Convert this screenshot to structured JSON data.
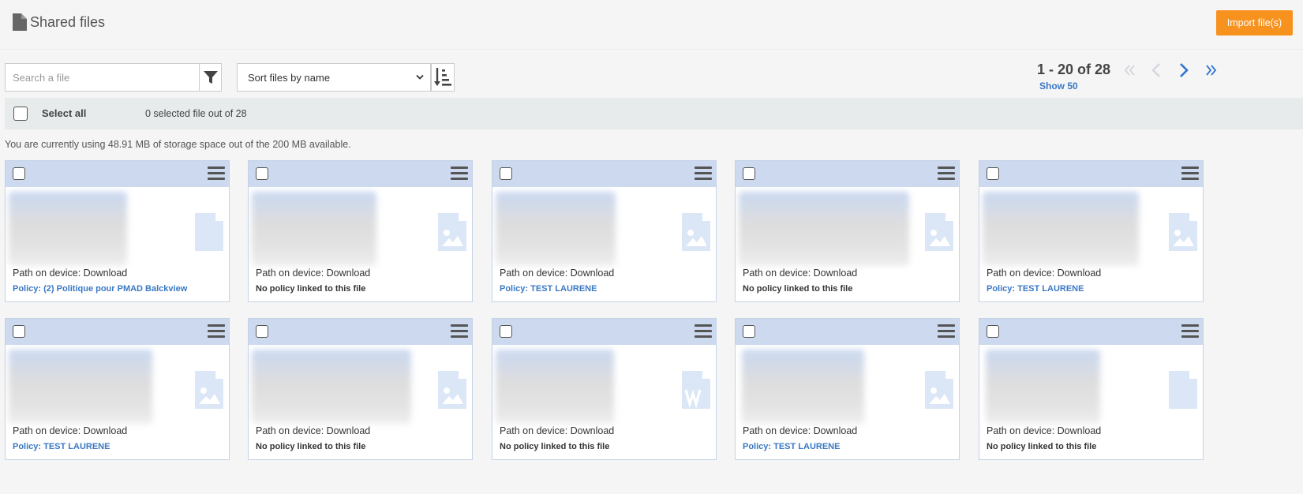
{
  "header": {
    "title": "Shared files",
    "import_label": "Import file(s)"
  },
  "toolbar": {
    "search_placeholder": "Search a file",
    "sort_label": "Sort files by name"
  },
  "pagination": {
    "range": "1 - 20 of 28",
    "show_more": "Show 50"
  },
  "selection": {
    "select_all_label": "Select all",
    "selected_count": "0 selected file out of 28"
  },
  "storage_text": "You are currently using 48.91 MB of storage space out of the 200 MB available.",
  "colors": {
    "accent": "#f7921e",
    "link": "#3a78c4",
    "card_header": "#ccd9ee"
  },
  "files": [
    {
      "path": "Path on device: Download",
      "policy": "Policy: (2) Politique pour PMAD Balckview",
      "linked": true,
      "icon": "generic-file-icon"
    },
    {
      "path": "Path on device: Download",
      "policy": "No policy linked to this file",
      "linked": false,
      "icon": "image-file-icon"
    },
    {
      "path": "Path on device: Download",
      "policy": "Policy: TEST LAURENE",
      "linked": true,
      "icon": "image-file-icon"
    },
    {
      "path": "Path on device: Download",
      "policy": "No policy linked to this file",
      "linked": false,
      "icon": "image-file-icon"
    },
    {
      "path": "Path on device: Download",
      "policy": "Policy: TEST LAURENE",
      "linked": true,
      "icon": "image-file-icon"
    },
    {
      "path": "Path on device: Download",
      "policy": "Policy: TEST LAURENE",
      "linked": true,
      "icon": "image-file-icon"
    },
    {
      "path": "Path on device: Download",
      "policy": "No policy linked to this file",
      "linked": false,
      "icon": "image-file-icon"
    },
    {
      "path": "Path on device: Download",
      "policy": "No policy linked to this file",
      "linked": false,
      "icon": "word-file-icon"
    },
    {
      "path": "Path on device: Download",
      "policy": "Policy: TEST LAURENE",
      "linked": true,
      "icon": "image-file-icon"
    },
    {
      "path": "Path on device: Download",
      "policy": "No policy linked to this file",
      "linked": false,
      "icon": "generic-file-icon"
    }
  ]
}
